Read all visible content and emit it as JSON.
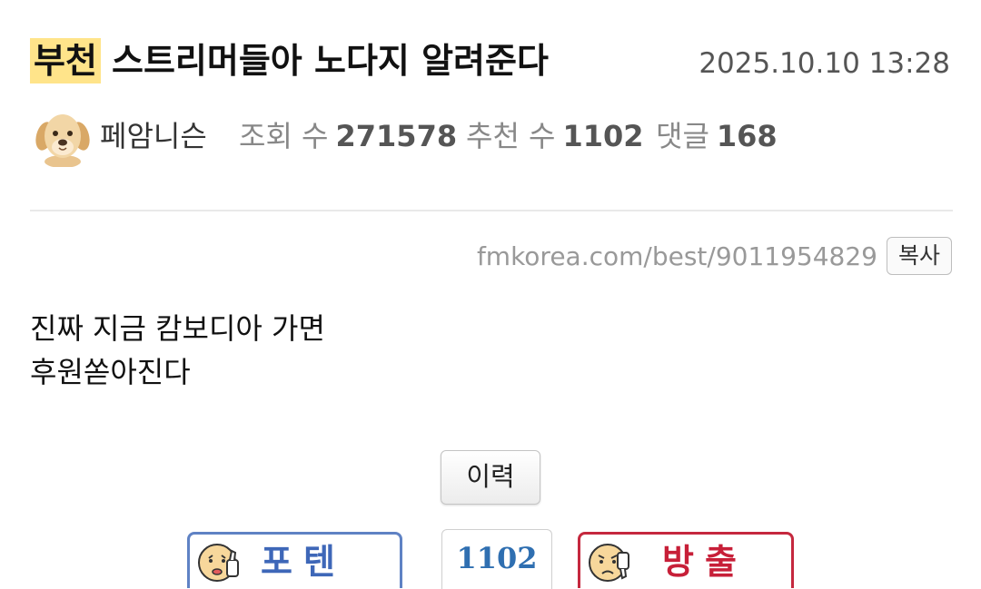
{
  "post": {
    "board_tag": "부천",
    "title": "스트리머들아 노다지 알려준다",
    "datetime": "2025.10.10 13:28",
    "author": "페암니슨",
    "views_label": "조회 수",
    "views": "271578",
    "recommend_label": "추천 수",
    "recommend": "1102",
    "comments_label": "댓글",
    "comments": "168"
  },
  "link": {
    "url": "fmkorea.com/best/9011954829",
    "copy_label": "복사"
  },
  "content": {
    "lines": [
      "진짜 지금 캄보디아 가면",
      "후원쏟아진다"
    ]
  },
  "actions": {
    "history_label": "이력",
    "vote_up_label": "포텐",
    "vote_count": "1102",
    "vote_down_label": "방출"
  },
  "icons": {
    "avatar": "puppy-avatar-icon",
    "vote_up": "thumbs-up-face-icon",
    "vote_down": "thumbs-down-face-icon"
  },
  "colors": {
    "tag_highlight": "#ffe48a",
    "vote_up": "#3e67b8",
    "vote_down": "#c71f38",
    "vote_count": "#2f6fb1"
  }
}
